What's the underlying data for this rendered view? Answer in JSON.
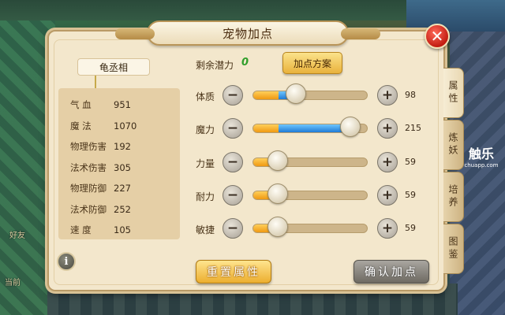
{
  "window": {
    "title": "宠物加点",
    "close_label": "✕"
  },
  "pet": {
    "name": "龟丞相"
  },
  "stats": [
    {
      "label": "气 血",
      "value": "951"
    },
    {
      "label": "魔 法",
      "value": "1070"
    },
    {
      "label": "物理伤害",
      "value": "192"
    },
    {
      "label": "法术伤害",
      "value": "305"
    },
    {
      "label": "物理防御",
      "value": "227"
    },
    {
      "label": "法术防御",
      "value": "252"
    },
    {
      "label": "速 度",
      "value": "105"
    }
  ],
  "info_icon": "i",
  "potential": {
    "label": "剩余潜力",
    "value": "0"
  },
  "scheme_button": "加点方案",
  "attributes": [
    {
      "label": "体质",
      "value": "98",
      "base_fill": 0.22,
      "added_fill": 0.14,
      "knob": 0.38
    },
    {
      "label": "魔力",
      "value": "215",
      "base_fill": 0.22,
      "added_fill": 0.63,
      "knob": 0.85
    },
    {
      "label": "力量",
      "value": "59",
      "base_fill": 0.22,
      "added_fill": 0.0,
      "knob": 0.22
    },
    {
      "label": "耐力",
      "value": "59",
      "base_fill": 0.22,
      "added_fill": 0.0,
      "knob": 0.22
    },
    {
      "label": "敏捷",
      "value": "59",
      "base_fill": 0.22,
      "added_fill": 0.0,
      "knob": 0.22
    }
  ],
  "buttons": {
    "reset": "重置属性",
    "confirm": "确认加点",
    "minus": "−",
    "plus": "+"
  },
  "side_tabs": [
    "属性",
    "炼妖",
    "培养",
    "图鉴"
  ],
  "watermark": {
    "line1": "触乐",
    "line2": "chuapp.com"
  },
  "background": {
    "chat_label": "好友",
    "bottom_left_text": "当前"
  },
  "colors": {
    "fill_base": "#f09a12",
    "fill_added": "#1f7ad6",
    "potential": "#2f9e2a",
    "close": "#c21d12"
  }
}
